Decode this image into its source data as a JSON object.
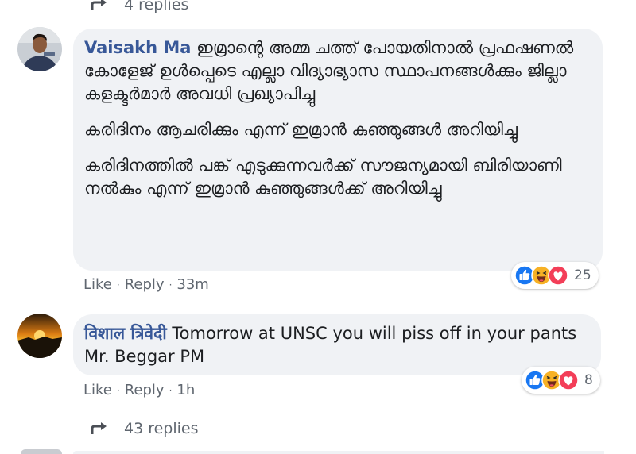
{
  "top_replies": {
    "label": "4 replies"
  },
  "comment1": {
    "author": "Vaisakh Ma",
    "paragraph1": "ഇമ്രാന്റെ അമ്മ ചത്ത് പോയതിനാൽ പ്രഫഷണൽ കോളേജ് ഉൾപ്പെടെ എല്ലാ വിദ്യാഭ്യാസ സ്ഥാപനങ്ങൾക്കും ജില്ലാ കളക്ടർമാർ അവധി പ്രഖ്യാപിച്ചു",
    "paragraph2": "കരിദിനം ആചരിക്കും എന്ന് ഇമ്രാൻ കുഞ്ഞുങ്ങൾ അറിയിച്ചു",
    "paragraph3": "കരിദിനത്തിൽ പങ്ക് എടുക്കുന്നവർക്ക് സൗജന്യമായി ബിരിയാണി നൽകും എന്ന് ഇമ്രാൻ കുഞ്ഞുങ്ങൾക്ക് അറിയിച്ചു",
    "like_label": "Like",
    "reply_label": "Reply",
    "time": "33m",
    "reaction_count": "25",
    "reaction_icons": [
      "like-icon",
      "haha-icon",
      "love-icon"
    ]
  },
  "comment2": {
    "author": "विशाल त्रिवेदी",
    "text": "Tomorrow at UNSC you will piss off in your pants Mr. Beggar PM",
    "like_label": "Like",
    "reply_label": "Reply",
    "time": "1h",
    "reaction_count": "8",
    "reaction_icons": [
      "like-icon",
      "haha-icon",
      "love-icon"
    ]
  },
  "bottom_replies": {
    "label": "43 replies"
  },
  "colors": {
    "bubble": "#f0f2f5",
    "author": "#385898",
    "meta": "#606770",
    "like": "#1877f2",
    "haha": "#f7b125",
    "love": "#f33e58"
  }
}
